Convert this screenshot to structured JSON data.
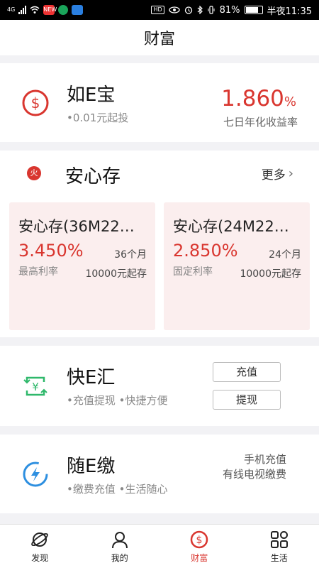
{
  "status_bar": {
    "network": "4G",
    "battery": "81%",
    "time": "半夜11:35",
    "hd": "HD",
    "app1_text": "NEW"
  },
  "header": {
    "title": "财富"
  },
  "rue": {
    "title": "如E宝",
    "sub": "•0.01元起投",
    "rate": "1.860",
    "rate_suffix": "%",
    "rate_label": "七日年化收益率"
  },
  "anxincun": {
    "badge": "火",
    "title": "安心存",
    "more": "更多",
    "products": [
      {
        "name": "安心存(36M22…",
        "rate": "3.450%",
        "term": "36个月",
        "rate_label": "最高利率",
        "min": "10000元起存"
      },
      {
        "name": "安心存(24M22…",
        "rate": "2.850%",
        "term": "24个月",
        "rate_label": "固定利率",
        "min": "10000元起存"
      }
    ]
  },
  "kuai": {
    "title": "快E汇",
    "sub": "•充值提现 •快捷方便",
    "btn_charge": "充值",
    "btn_withdraw": "提现"
  },
  "sui": {
    "title": "随E缴",
    "sub": "•缴费充值 •生活随心",
    "right1": "手机充值",
    "right2": "有线电视缴费"
  },
  "nav": {
    "items": [
      {
        "label": "发现",
        "icon": "planet-icon"
      },
      {
        "label": "我的",
        "icon": "user-icon"
      },
      {
        "label": "财富",
        "icon": "dollar-coin-icon"
      },
      {
        "label": "生活",
        "icon": "grid-icon"
      }
    ],
    "active_index": 2
  },
  "colors": {
    "accent": "#d9362f",
    "green": "#2fb86b",
    "blue": "#2d8fe0",
    "card_pink": "#fbeeee"
  }
}
